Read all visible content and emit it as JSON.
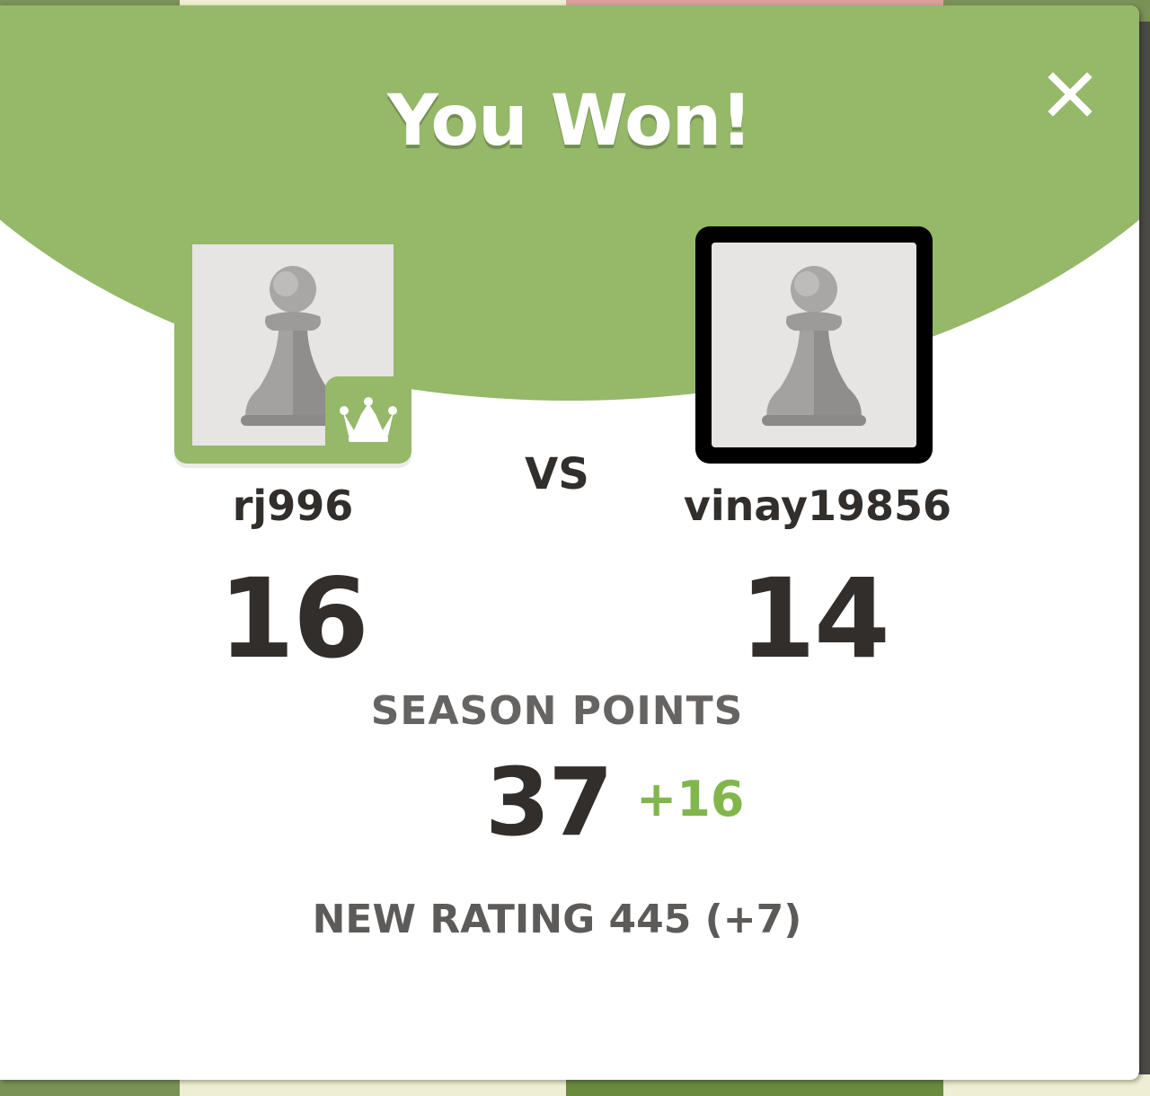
{
  "modal": {
    "title": "You Won!",
    "close_icon": "close-icon",
    "header_color": "#95b869"
  },
  "players": {
    "left": {
      "username": "rj996",
      "score": "16",
      "avatar_icon": "pawn-icon",
      "badge_icon": "crown-icon",
      "is_winner": true
    },
    "vs_label": "VS",
    "right": {
      "username": "vinay19856",
      "score": "14",
      "avatar_icon": "pawn-icon",
      "is_winner": false
    }
  },
  "season": {
    "label": "SEASON POINTS",
    "points": "37",
    "delta": "+16",
    "delta_color": "#81b64c"
  },
  "rating": {
    "text": "NEW RATING 445 (+7)"
  }
}
